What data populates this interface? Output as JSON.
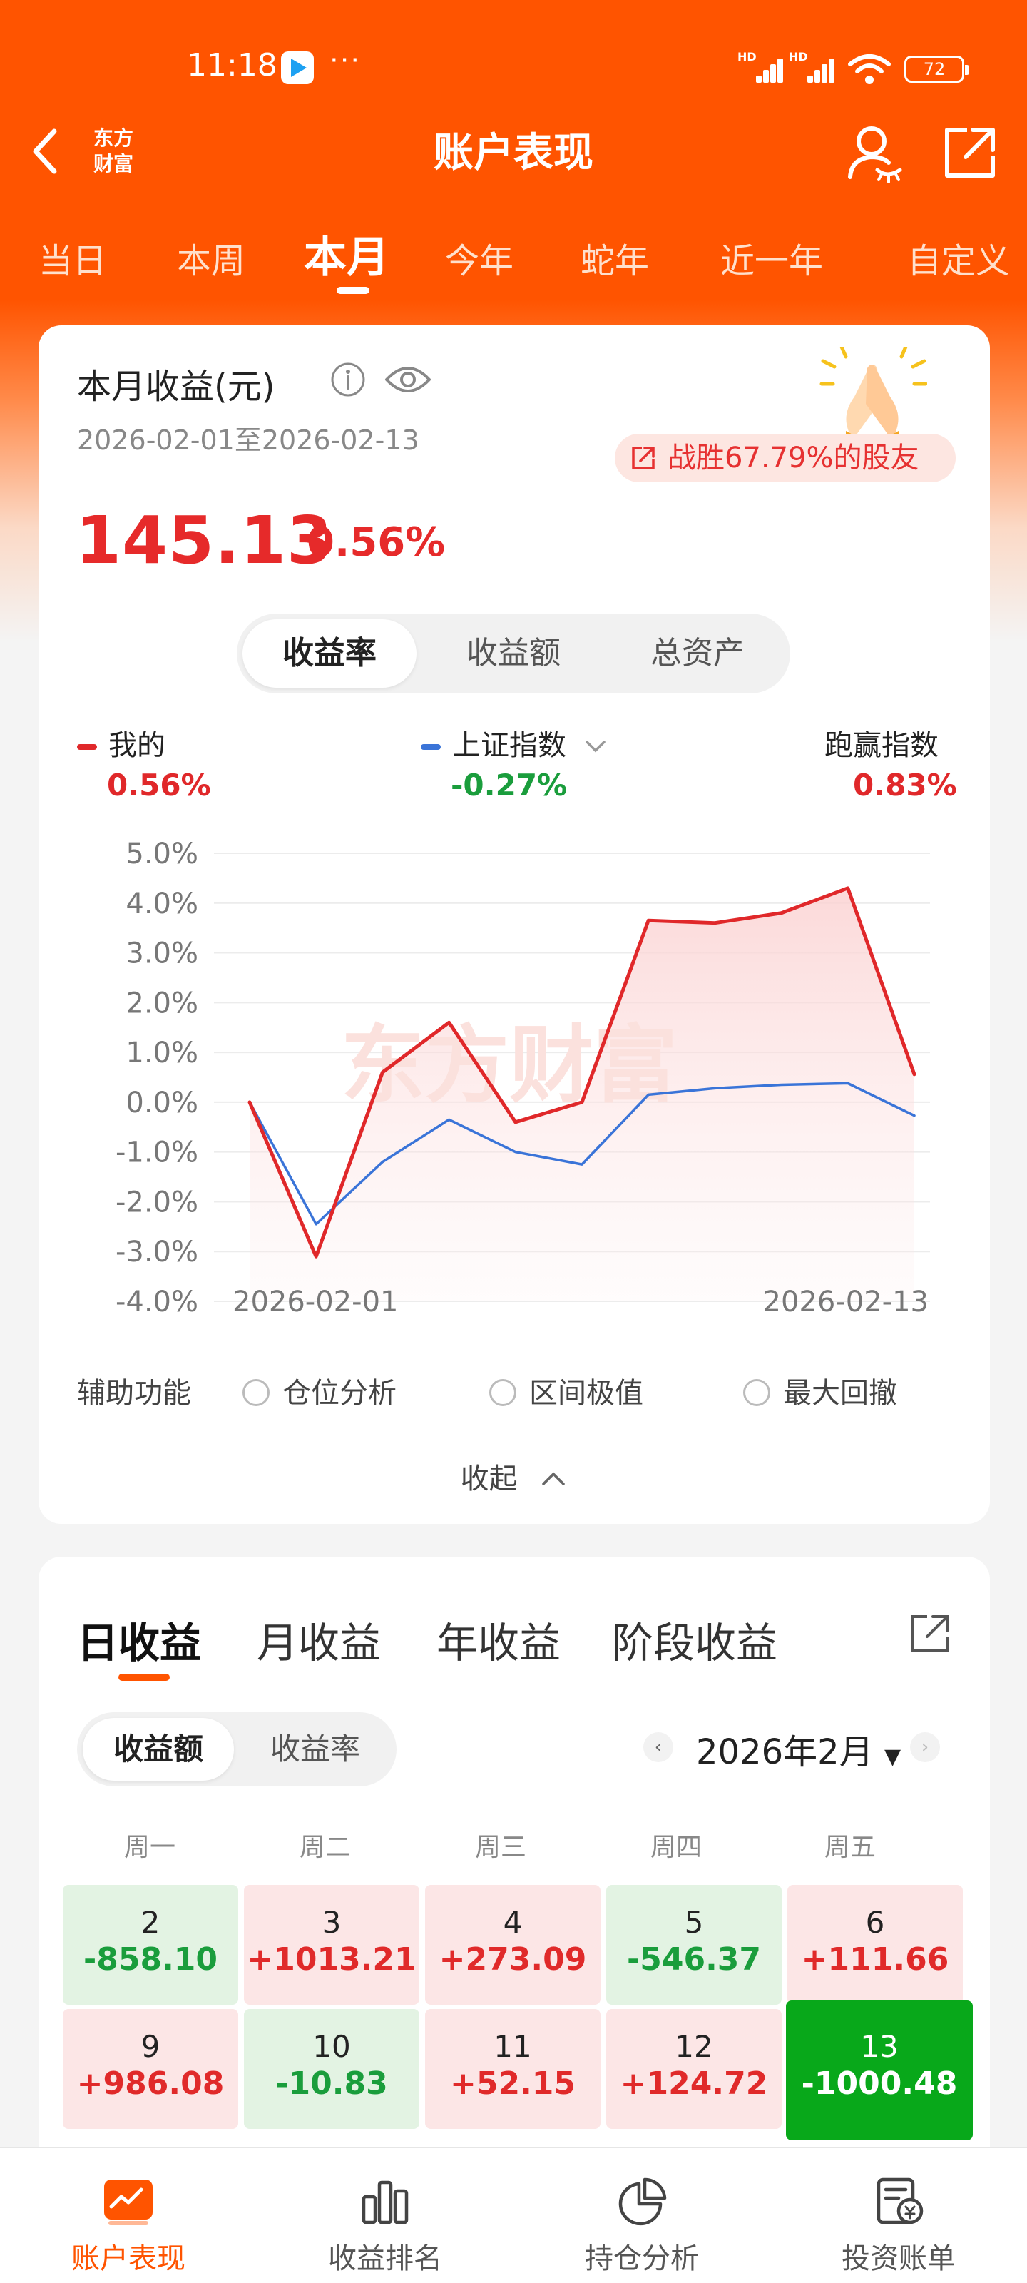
{
  "status_bar": {
    "time": "11:18",
    "dots": "···",
    "battery": "72",
    "network_label": "HD"
  },
  "header": {
    "back_icon": "chevron-left-icon",
    "logo_line1": "东方",
    "logo_line2": "财富",
    "title": "账户表现"
  },
  "period_tabs": [
    "当日",
    "本周",
    "本月",
    "今年",
    "蛇年",
    "近一年",
    "自定义"
  ],
  "active_period": "本月",
  "summary": {
    "label": "本月收益(元)",
    "date_range": "2026-02-01至2026-02-13",
    "beat_text": "战胜67.79%的股友",
    "amount": "145.13",
    "percent": "0.56%"
  },
  "metric_toggle": {
    "options": [
      "收益率",
      "收益额",
      "总资产"
    ],
    "selected": "收益率"
  },
  "legend": {
    "mine_label": "我的",
    "mine_value": "0.56%",
    "index_label": "上证指数",
    "index_value": "-0.27%",
    "beat_label": "跑赢指数",
    "beat_value": "0.83%"
  },
  "chart_data": {
    "type": "line",
    "x": [
      "2026-02-01",
      "2026-02-02",
      "2026-02-03",
      "2026-02-04",
      "2026-02-05",
      "2026-02-06",
      "2026-02-09",
      "2026-02-10",
      "2026-02-11",
      "2026-02-12",
      "2026-02-13"
    ],
    "x_tick_labels": [
      "2026-02-01",
      "2026-02-13"
    ],
    "y_tick_labels": [
      "5.0%",
      "4.0%",
      "3.0%",
      "2.0%",
      "1.0%",
      "0.0%",
      "-1.0%",
      "-2.0%",
      "-3.0%",
      "-4.0%"
    ],
    "ylim": [
      -4.0,
      5.0
    ],
    "grid": true,
    "series": [
      {
        "name": "我的",
        "color": "#e0282a",
        "values": [
          0.0,
          -3.1,
          0.6,
          1.6,
          -0.4,
          0.0,
          3.65,
          3.6,
          3.8,
          4.3,
          0.56
        ]
      },
      {
        "name": "上证指数",
        "color": "#3a74d8",
        "values": [
          0.0,
          -2.45,
          -1.2,
          -0.35,
          -1.0,
          -1.25,
          0.15,
          0.28,
          0.35,
          0.38,
          -0.27
        ]
      }
    ],
    "watermark": "东方财富"
  },
  "aux": {
    "label": "辅助功能",
    "options": [
      "仓位分析",
      "区间极值",
      "最大回撤"
    ],
    "collapse": "收起"
  },
  "returns": {
    "tabs": [
      "日收益",
      "月收益",
      "年收益",
      "阶段收益"
    ],
    "active_tab": "日收益",
    "toggle": {
      "options": [
        "收益额",
        "收益率"
      ],
      "selected": "收益额"
    },
    "month": "2026年2月",
    "weekdays": [
      "周一",
      "周二",
      "周三",
      "周四",
      "周五"
    ],
    "rows": [
      [
        {
          "day": "2",
          "value": "-858.10",
          "sign": "neg"
        },
        {
          "day": "3",
          "value": "+1013.21",
          "sign": "pos"
        },
        {
          "day": "4",
          "value": "+273.09",
          "sign": "pos"
        },
        {
          "day": "5",
          "value": "-546.37",
          "sign": "neg"
        },
        {
          "day": "6",
          "value": "+111.66",
          "sign": "pos"
        }
      ],
      [
        {
          "day": "9",
          "value": "+986.08",
          "sign": "pos"
        },
        {
          "day": "10",
          "value": "-10.83",
          "sign": "neg"
        },
        {
          "day": "11",
          "value": "+52.15",
          "sign": "pos"
        },
        {
          "day": "12",
          "value": "+124.72",
          "sign": "pos"
        },
        {
          "day": "13",
          "value": "-1000.48",
          "sign": "hl"
        }
      ]
    ]
  },
  "bottom_nav": [
    {
      "label": "账户表现",
      "icon": "chart-icon",
      "active": true
    },
    {
      "label": "收益排名",
      "icon": "bar-chart-icon",
      "active": false
    },
    {
      "label": "持仓分析",
      "icon": "pie-chart-icon",
      "active": false
    },
    {
      "label": "投资账单",
      "icon": "bill-icon",
      "active": false
    }
  ],
  "colors": {
    "brand": "#ff5400",
    "up": "#e02a2a",
    "down": "#1a9d3c",
    "index_line": "#3a74d8"
  }
}
